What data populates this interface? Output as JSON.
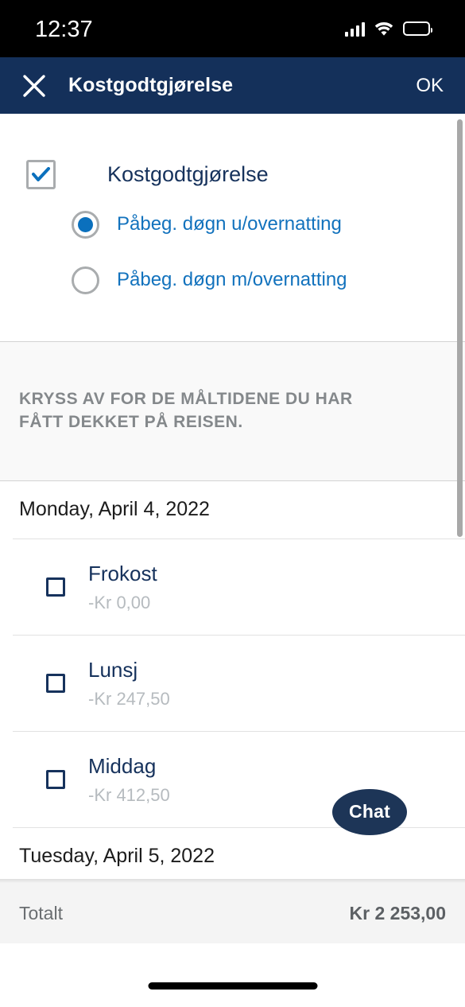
{
  "status_bar": {
    "time": "12:37",
    "icons": [
      "cellular-signal-icon",
      "wifi-icon",
      "battery-icon"
    ],
    "background": "#000000"
  },
  "nav_bar": {
    "close_icon": "close-icon",
    "title": "Kostgodtgjørelse",
    "action_label": "OK",
    "background": "#14305a",
    "text_color": "#ffffff"
  },
  "option_block": {
    "main_checkbox": {
      "label": "Kostgodtgjørelse",
      "checked": true,
      "check_color": "#0b70bd",
      "border_color": "#a9acae",
      "label_color": "#16325c"
    },
    "radios": [
      {
        "label": "Påbeg. døgn u/overnatting",
        "selected": true
      },
      {
        "label": "Påbeg. døgn m/overnatting",
        "selected": false
      }
    ],
    "radio_label_color": "#1272bd",
    "radio_accent": "#0b70bd"
  },
  "instruction": {
    "text": "Kryss av for de måltidene du har fått dekket på reisen.",
    "text_color": "#84888b",
    "background": "#f9f9f9"
  },
  "days": [
    {
      "date": "Monday, April 4, 2022",
      "meals": [
        {
          "name": "Frokost",
          "price": "-Kr 0,00",
          "checked": false
        },
        {
          "name": "Lunsj",
          "price": "-Kr 247,50",
          "checked": false
        },
        {
          "name": "Middag",
          "price": "-Kr 412,50",
          "checked": false
        }
      ]
    },
    {
      "date": "Tuesday, April 5, 2022",
      "meals": []
    }
  ],
  "meal_colors": {
    "name": "#16325c",
    "price": "#b6bbbf",
    "checkbox_border": "#16325c"
  },
  "chat_widget": {
    "label": "Chat",
    "background": "#1d3557",
    "text_color": "#ffffff"
  },
  "footer": {
    "label": "Totalt",
    "amount": "Kr 2 253,00",
    "background": "#f4f4f4",
    "label_color": "#6a6e71",
    "amount_color": "#5c6064"
  },
  "scrollbar": {
    "visible": true,
    "color": "#a8a8a8"
  },
  "home_indicator": {
    "visible": true,
    "color": "#000000"
  }
}
